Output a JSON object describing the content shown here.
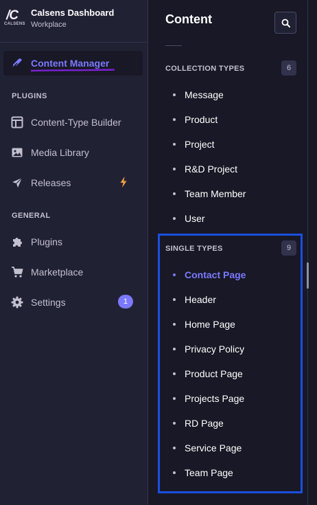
{
  "brand": {
    "logo_mark": "/C",
    "logo_text": "CALSENS",
    "title": "Calsens Dashboard",
    "subtitle": "Workplace"
  },
  "sidebar": {
    "main_item": {
      "label": "Content Manager",
      "icon": "feather-icon",
      "active": true
    },
    "plugins_heading": "PLUGINS",
    "plugins": [
      {
        "label": "Content-Type Builder",
        "icon": "layout-icon"
      },
      {
        "label": "Media Library",
        "icon": "image-icon"
      },
      {
        "label": "Releases",
        "icon": "paper-plane-icon",
        "indicator": "lightning-icon"
      }
    ],
    "general_heading": "GENERAL",
    "general": [
      {
        "label": "Plugins",
        "icon": "puzzle-icon"
      },
      {
        "label": "Marketplace",
        "icon": "cart-icon"
      },
      {
        "label": "Settings",
        "icon": "gear-icon",
        "badge": "1"
      }
    ]
  },
  "panel": {
    "title": "Content",
    "search_icon": "search-icon",
    "collection_types": {
      "heading": "COLLECTION TYPES",
      "count": "6",
      "items": [
        "Message",
        "Product",
        "Project",
        "R&D Project",
        "Team Member",
        "User"
      ]
    },
    "single_types": {
      "heading": "SINGLE TYPES",
      "count": "9",
      "active_item": "Contact Page",
      "items": [
        "Contact Page",
        "Header",
        "Home Page",
        "Privacy Policy",
        "Product Page",
        "Projects Page",
        "RD Page",
        "Service Page",
        "Team Page"
      ]
    }
  },
  "colors": {
    "accent": "#7b79ff",
    "sidebar_bg": "#212134",
    "page_bg": "#181826",
    "highlight_border": "#1a4fe0",
    "underline_stroke": "#7b21d6",
    "bolt": "#f29d41"
  }
}
